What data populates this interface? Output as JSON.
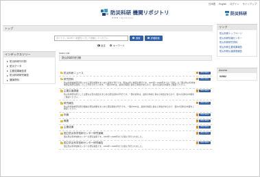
{
  "header": {
    "top_links": [
      "日本語",
      "English",
      "ログイン",
      "サインアップ"
    ],
    "repo_title": "防災科研 機関リポジトリ",
    "repo_subtitle": "NIED repository",
    "org_logo_text": "防災科研"
  },
  "topbar": {
    "label": "トップ"
  },
  "search": {
    "placeholder": "タイトル、DOIや一本語を入力して検索してください",
    "search_label": "検索",
    "advanced_label": "詳細検索",
    "radio_options": [
      "全文",
      "キーワード"
    ],
    "selected": "全文"
  },
  "index_tree": {
    "title": "インデックスツリー",
    "items": [
      "防災科研刊行物",
      "防災データ",
      "主要成果報告書",
      "防災科研研究報告",
      "講演資料"
    ]
  },
  "main": {
    "list_label": "Index List",
    "current_index": "防災科研刊行物",
    "feed_button_label": "RSS Notice",
    "rows": [
      {
        "title": "防災科研ニュース",
        "desc": ""
      },
      {
        "title": "研究資料",
        "desc": "防災科学技術研究所における研究成果をまとめた資料の刊行です。現在は年に数回の発行です。1967年〜1999年までの「資料」は「国立防災科学技術研究所研究資料」として刊行されています。一部のPDFは、最新の情報と異なる場合があるので、個々の資料の内容をご確認ください。"
      },
      {
        "title": "主要災害調査",
        "desc": "防災科学研究所として主要な災害の調査をまとめた研究資料の刊行です。一部の資料は、最新の情報と異なる場合があるので、個々の資料の内容をご確認ください。"
      },
      {
        "title": "研究報告",
        "desc": "防災科学技術研究所の職員の研究成果をまとめた研究報告の刊行です。一部のPDFは、最新の情報と異なる場合があるので、個々の資料の内容をご確認ください。"
      },
      {
        "title": "年報",
        "desc": ""
      },
      {
        "title": "概要",
        "desc": ""
      },
      {
        "title": "主要成果",
        "desc": ""
      },
      {
        "title": "国立防災科学技術センター研究速報",
        "desc": "国立防災科学技術センターの研究速報です。1963年〜1990年までの間に刊行されました。"
      },
      {
        "title": "国立防災科学技術センター研究報告",
        "desc": "国立防災科学技術センターの研究報告です。1963年〜1990年までの間に刊行されました。"
      }
    ]
  },
  "links": {
    "title": "リンク",
    "items": [
      "防災科研トップページ",
      "防災科研情報センター",
      "防災科研研究資料",
      "防災科研主要成果報告",
      "防災科研災害調査報告"
    ]
  },
  "access": {
    "title": "Access",
    "count": "92982"
  },
  "colors": {
    "accent": "#2f5fa6",
    "rss": "#f08a24",
    "brand": "#1f3c73"
  }
}
